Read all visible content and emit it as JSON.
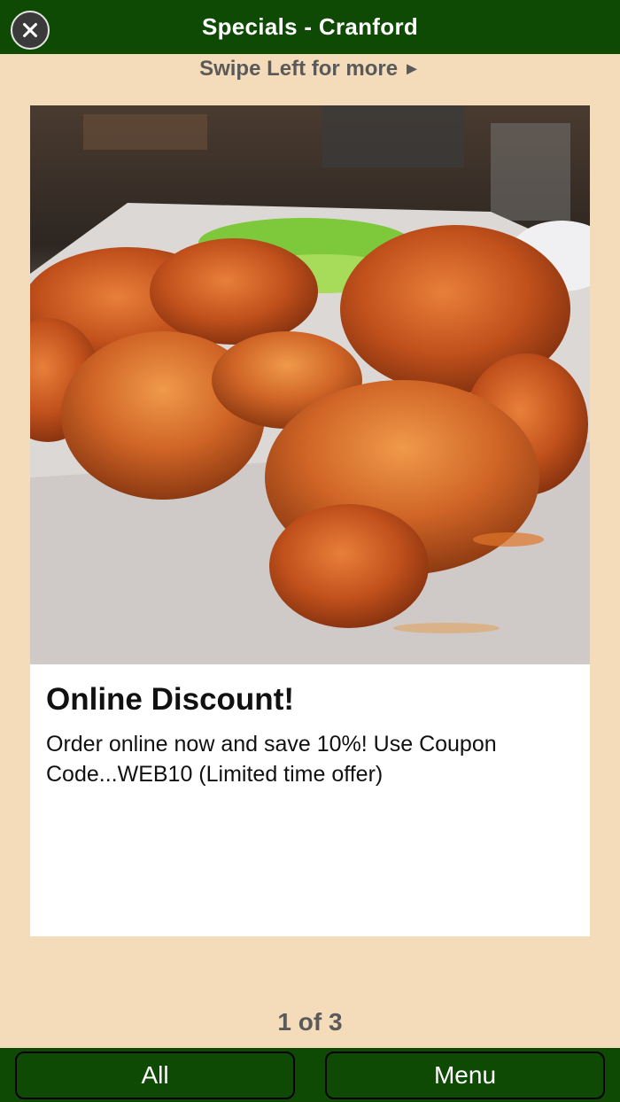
{
  "header": {
    "title": "Specials - Cranford",
    "close_icon": "close-circle-icon"
  },
  "swipe_hint": {
    "label": "Swipe Left for more",
    "arrow": "►"
  },
  "special": {
    "image_subject": "food-photo-wings",
    "title": "Online Discount!",
    "description": "Order online now and save 10%! Use Coupon Code...WEB10 (Limited time offer)"
  },
  "pager": {
    "label": "1 of 3"
  },
  "bottom_nav": {
    "all_label": "All",
    "menu_label": "Menu"
  },
  "colors": {
    "bar_green": "#0f4a05",
    "background": "#f4dcbb"
  }
}
